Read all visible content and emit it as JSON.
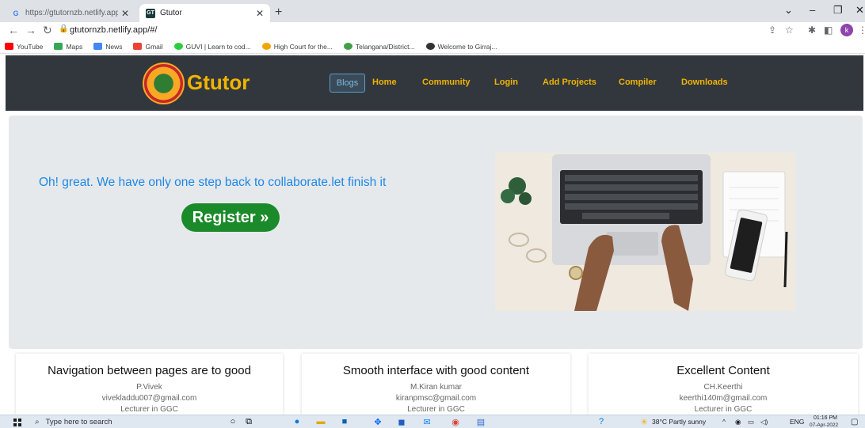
{
  "browser": {
    "tabs": [
      {
        "title": "https://gtutornzb.netlify.app/",
        "favicon": "G",
        "active": false
      },
      {
        "title": "Gtutor",
        "favicon": "GT",
        "active": true
      }
    ],
    "url": "gtutornzb.netlify.app/#/",
    "profile_initial": "k",
    "bookmarks": [
      {
        "label": "YouTube",
        "color": "#ff0000"
      },
      {
        "label": "Maps",
        "color": "#34a853"
      },
      {
        "label": "News",
        "color": "#4285f4"
      },
      {
        "label": "Gmail",
        "color": "#ea4335"
      },
      {
        "label": "GUVI | Learn to cod...",
        "color": "#2ecc40"
      },
      {
        "label": "High Court for the...",
        "color": "#f0a500"
      },
      {
        "label": "Telangana/District...",
        "color": "#43a047"
      },
      {
        "label": "Welcome to Girraj...",
        "color": "#333333"
      }
    ]
  },
  "site": {
    "brand": "Gtutor",
    "nav": {
      "blogs": "Blogs",
      "home": "Home",
      "community": "Community",
      "login": "Login",
      "add_projects": "Add Projects",
      "compiler": "Compiler",
      "downloads": "Downloads"
    },
    "hero": {
      "text": "Oh! great. We have only one step back to collaborate.let finish it",
      "register_label": "Register »"
    },
    "cards": [
      {
        "title": "Navigation between pages are to good",
        "name": "P.Vivek",
        "email": "vivekladdu007@gmail.com",
        "role": "Lecturer in GGC"
      },
      {
        "title": "Smooth interface with good content",
        "name": "M.Kiran kumar",
        "email": "kiranpmsc@gmail.com",
        "role": "Lecturer in GGC"
      },
      {
        "title": "Excellent Content",
        "name": "CH.Keerthi",
        "email": "keerthi140m@gmail.com",
        "role": "Lecturer in GGC"
      }
    ]
  },
  "taskbar": {
    "search_placeholder": "Type here to search",
    "weather": "38°C  Partly sunny",
    "language": "ENG",
    "time": "01:16 PM",
    "date": "07-Apr-2022"
  },
  "colors": {
    "navbar_bg": "#32373d",
    "brand_gold": "#f0b400",
    "hero_bg": "#e6e9ec",
    "hero_text": "#1e88e5",
    "register_green": "#1b8a2a"
  }
}
